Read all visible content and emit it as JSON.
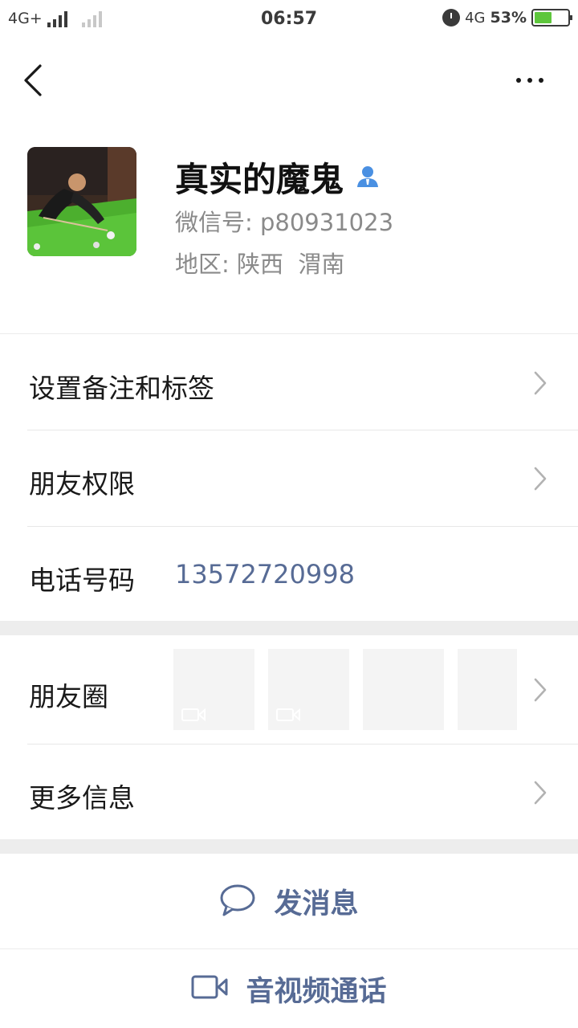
{
  "status_bar": {
    "network_left": "4G+",
    "time": "06:57",
    "network_right": "4G",
    "battery_percent_text": "53%",
    "battery_level": 0.53,
    "battery_color": "#5ec63c"
  },
  "nav": {
    "back_icon": "chevron-left-icon",
    "more_icon": "more-dots-icon"
  },
  "profile": {
    "name": "真实的魔鬼",
    "badge_icon": "user-icon",
    "badge_color": "#4a90e2",
    "wechat_id_label": "微信号:",
    "wechat_id_value": "p80931023",
    "region_label": "地区:",
    "region_value": "陕西  渭南"
  },
  "rows": {
    "remark_label": "设置备注和标签",
    "permission_label": "朋友权限",
    "phone_label": "电话号码",
    "phone_value": "13572720998",
    "moments_label": "朋友圈",
    "more_info_label": "更多信息"
  },
  "actions": {
    "message_label": "发消息",
    "call_label": "音视频通话",
    "link_color": "#576b95"
  }
}
